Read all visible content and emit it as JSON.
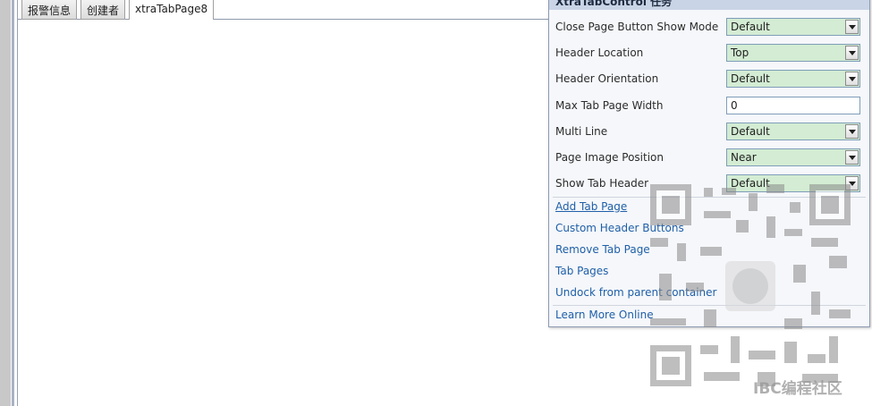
{
  "tabs": [
    {
      "label": "报警信息"
    },
    {
      "label": "创建者"
    },
    {
      "label": "xtraTabPage8"
    }
  ],
  "panel": {
    "title": "XtraTabControl 任务",
    "properties": [
      {
        "label": "Close Page Button Show Mode",
        "value": "Default",
        "kind": "dropdown"
      },
      {
        "label": "Header Location",
        "value": "Top",
        "kind": "dropdown"
      },
      {
        "label": "Header Orientation",
        "value": "Default",
        "kind": "dropdown"
      },
      {
        "label": "Max Tab Page Width",
        "value": "0",
        "kind": "text"
      },
      {
        "label": "Multi Line",
        "value": "Default",
        "kind": "dropdown"
      },
      {
        "label": "Page Image Position",
        "value": "Near",
        "kind": "dropdown"
      },
      {
        "label": "Show Tab Header",
        "value": "Default",
        "kind": "dropdown"
      }
    ],
    "actions": [
      {
        "label": "Add Tab Page"
      },
      {
        "label": "Custom Header Buttons"
      },
      {
        "label": "Remove Tab Page"
      },
      {
        "label": "Tab Pages"
      },
      {
        "label": "Undock from parent container"
      }
    ],
    "learn_more": "Learn More Online"
  },
  "watermark": {
    "text": "IBC编程社区"
  },
  "colors": {
    "dropdown_bg": "#d3ecd3",
    "link": "#1f5fa8",
    "panel_header": "#c9d4e6"
  }
}
